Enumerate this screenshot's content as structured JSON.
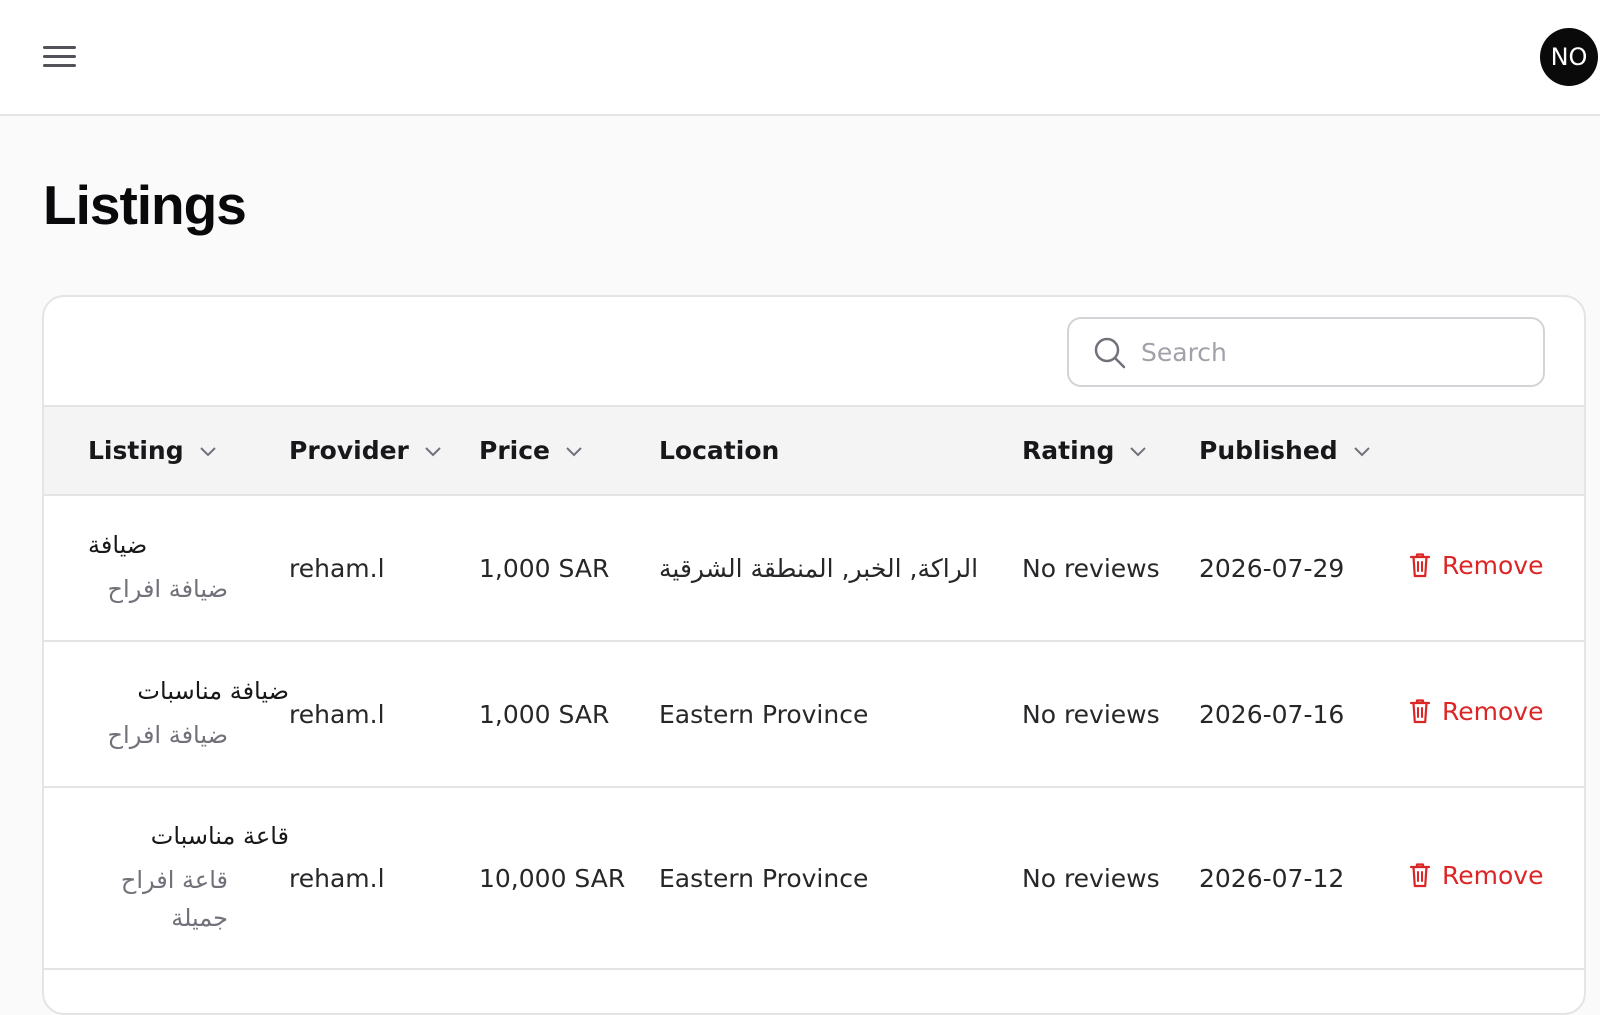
{
  "header": {
    "menu_icon": "menu-icon",
    "avatar_initials": "NO"
  },
  "page": {
    "title": "Listings"
  },
  "search": {
    "placeholder": "Search",
    "value": "",
    "icon": "search-icon"
  },
  "table": {
    "columns": [
      {
        "label": "Listing",
        "sortable": true
      },
      {
        "label": "Provider",
        "sortable": true
      },
      {
        "label": "Price",
        "sortable": true
      },
      {
        "label": "Location",
        "sortable": false
      },
      {
        "label": "Rating",
        "sortable": true
      },
      {
        "label": "Published",
        "sortable": true
      }
    ],
    "rows": [
      {
        "title": "ضيافة",
        "subtitle": "ضيافة افراح",
        "provider": "reham.l",
        "price": "1,000 SAR",
        "location": "الراكة, الخبر, المنطقة الشرقية",
        "rating": "No reviews",
        "published": "2026-07-29",
        "action": "Remove"
      },
      {
        "title": "ضيافة مناسبات",
        "subtitle": "ضيافة افراح",
        "provider": "reham.l",
        "price": "1,000 SAR",
        "location": "Eastern Province",
        "rating": "No reviews",
        "published": "2026-07-16",
        "action": "Remove"
      },
      {
        "title": "قاعة مناسبات",
        "subtitle": "قاعة افراح جميلة",
        "provider": "reham.l",
        "price": "10,000 SAR",
        "location": "Eastern Province",
        "rating": "No reviews",
        "published": "2026-07-12",
        "action": "Remove"
      }
    ]
  },
  "colors": {
    "danger": "#dc2626",
    "avatar_bg": "#0a0a0a",
    "header_row_bg": "#f4f4f5",
    "border": "#e4e4e7"
  }
}
